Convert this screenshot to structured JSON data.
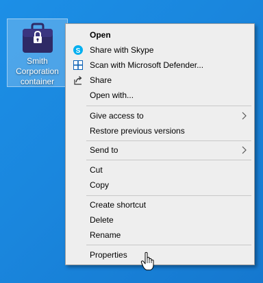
{
  "desktop": {
    "icon": {
      "name": "briefcase-icon",
      "label_line1": "Smith",
      "label_line2": "Corporation",
      "label_line3": "container"
    }
  },
  "context_menu": {
    "items": [
      {
        "label": "Open",
        "bold": true
      },
      {
        "label": "Share with Skype",
        "icon": "skype-icon"
      },
      {
        "label": "Scan with Microsoft Defender...",
        "icon": "defender-shield-icon"
      },
      {
        "label": "Share",
        "icon": "share-icon"
      },
      {
        "label": "Open with..."
      },
      {
        "label": "Give access to",
        "submenu": true
      },
      {
        "label": "Restore previous versions"
      },
      {
        "label": "Send to",
        "submenu": true
      },
      {
        "label": "Cut"
      },
      {
        "label": "Copy"
      },
      {
        "label": "Create shortcut"
      },
      {
        "label": "Delete"
      },
      {
        "label": "Rename"
      },
      {
        "label": "Properties"
      }
    ]
  },
  "colors": {
    "desktop_background": "#1a86dd",
    "menu_background": "#eeeeee",
    "skype_blue": "#00aff0",
    "briefcase_navy": "#2e2a66"
  }
}
